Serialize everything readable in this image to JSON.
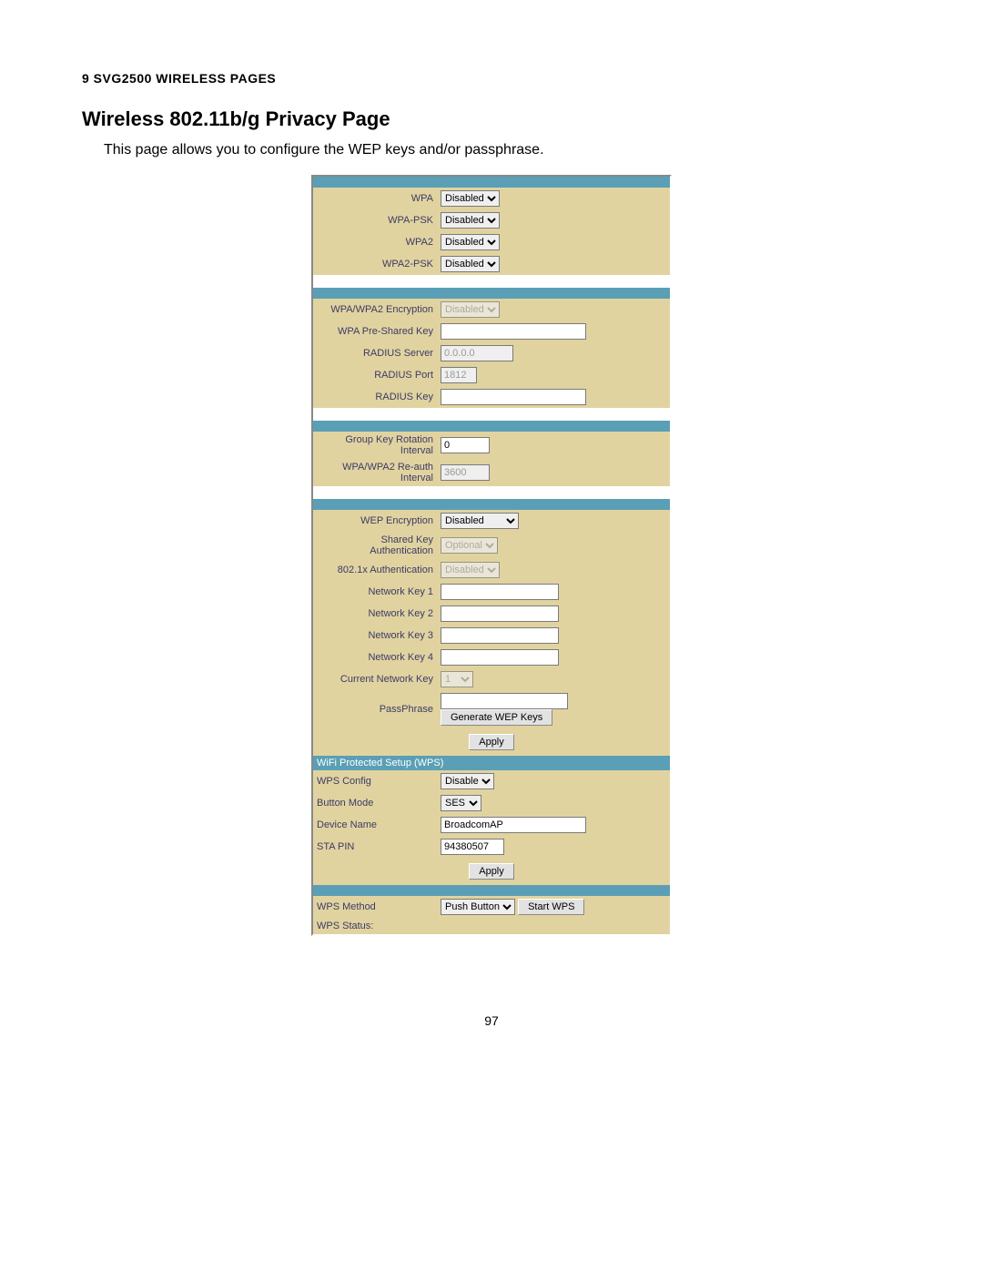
{
  "section_heading": "9 SVG2500 WIRELESS PAGES",
  "page_title": "Wireless 802.11b/g Privacy Page",
  "intro": "This page allows you to configure the WEP keys and/or passphrase.",
  "page_number": "97",
  "labels": {
    "wpa": "WPA",
    "wpa_psk": "WPA-PSK",
    "wpa2": "WPA2",
    "wpa2_psk": "WPA2-PSK",
    "wpa_enc": "WPA/WPA2 Encryption",
    "wpa_preshared": "WPA Pre-Shared Key",
    "radius_server": "RADIUS Server",
    "radius_port": "RADIUS Port",
    "radius_key": "RADIUS Key",
    "group_key_rot": "Group Key Rotation Interval",
    "reauth": "WPA/WPA2 Re-auth Interval",
    "wep_enc": "WEP Encryption",
    "shared_key_auth": "Shared Key Authentication",
    "dot1x_auth": "802.1x Authentication",
    "net_key1": "Network Key 1",
    "net_key2": "Network Key 2",
    "net_key3": "Network Key 3",
    "net_key4": "Network Key 4",
    "current_key": "Current Network Key",
    "passphrase": "PassPhrase",
    "wps_header": "WiFi Protected Setup (WPS)",
    "wps_config": "WPS Config",
    "button_mode": "Button Mode",
    "device_name": "Device Name",
    "sta_pin": "STA PIN",
    "wps_method": "WPS Method",
    "wps_status": "WPS Status:"
  },
  "values": {
    "wpa": "Disabled",
    "wpa_psk": "Disabled",
    "wpa2": "Disabled",
    "wpa2_psk": "Disabled",
    "wpa_enc": "Disabled",
    "wpa_preshared": "",
    "radius_server": "0.0.0.0",
    "radius_port": "1812",
    "radius_key": "",
    "group_key_rot": "0",
    "reauth": "3600",
    "wep_enc": "Disabled",
    "shared_key_auth": "Optional",
    "dot1x_auth": "Disabled",
    "net_key1": "",
    "net_key2": "",
    "net_key3": "",
    "net_key4": "",
    "current_key": "1",
    "passphrase": "",
    "wps_config": "Disable",
    "button_mode": "SES",
    "device_name": "BroadcomAP",
    "sta_pin": "94380507",
    "wps_method": "Push Button",
    "wps_status": ""
  },
  "buttons": {
    "gen_wep": "Generate WEP Keys",
    "apply": "Apply",
    "start_wps": "Start WPS"
  }
}
